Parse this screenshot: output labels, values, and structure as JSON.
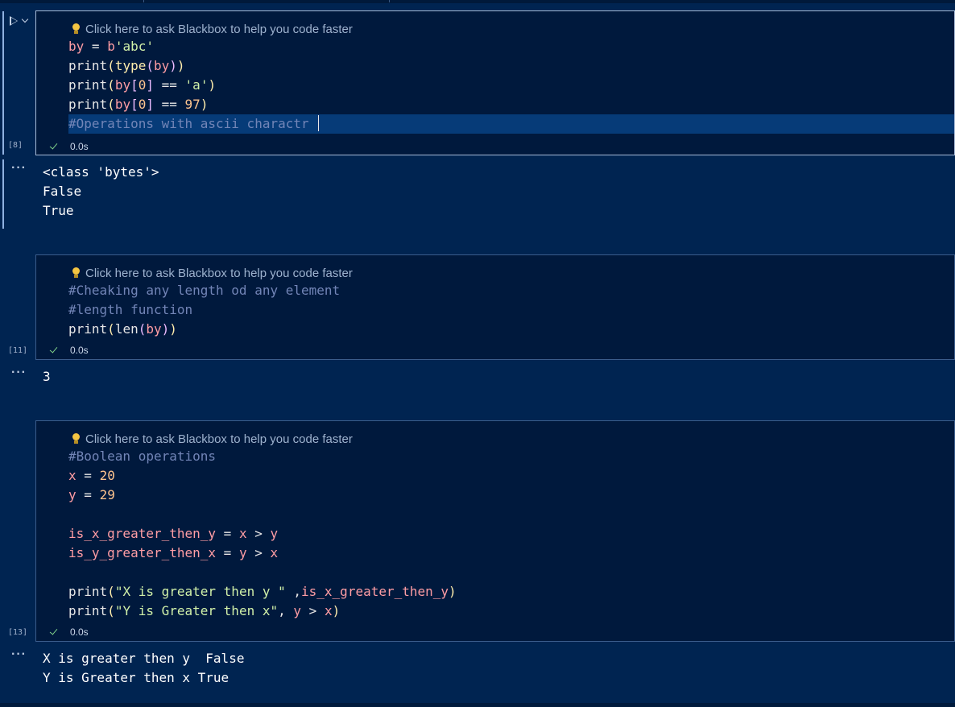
{
  "hint_text": "Click here to ask Blackbox to help you code faster",
  "cells": [
    {
      "exec_count": "[8]",
      "duration": "0.0s",
      "output": [
        "<class 'bytes'>",
        "False",
        "True"
      ]
    },
    {
      "exec_count": "[11]",
      "duration": "0.0s",
      "output": [
        "3"
      ]
    },
    {
      "exec_count": "[13]",
      "duration": "0.0s",
      "output": [
        "X is greater then y  False",
        "Y is Greater then x True"
      ]
    }
  ],
  "output_marker": "···",
  "colors": {
    "background": "#002451",
    "cell_bg": "#00193d",
    "cell_border": "#3b5d8c",
    "comment": "#7285b7",
    "variable": "#ff9da4",
    "number": "#ffc58f",
    "string": "#d1f1a9",
    "success_check": "#7fd18a"
  },
  "icons": [
    "run-icon",
    "chevron-down-icon",
    "lightbulb-icon",
    "check-icon",
    "ellipsis-icon"
  ]
}
